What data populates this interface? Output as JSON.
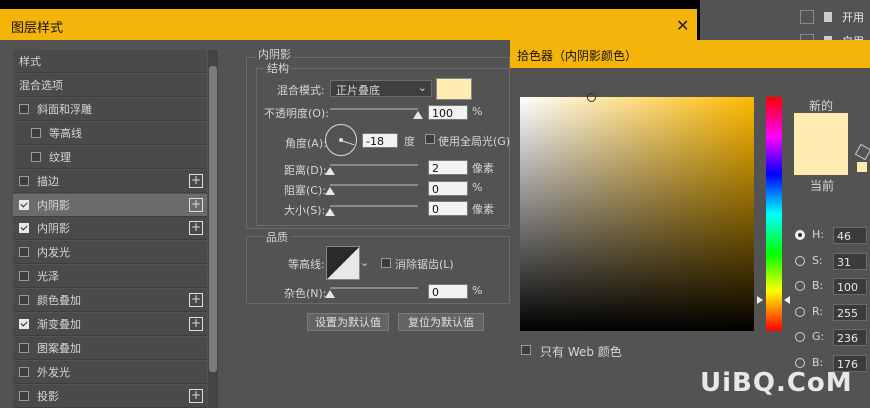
{
  "background": {
    "rows": [
      {
        "label": "开用"
      },
      {
        "label": "启用"
      },
      {
        "label": "使用"
      }
    ],
    "collapse_label": "«"
  },
  "dialog": {
    "title": "图层样式",
    "close_glyph": "✕",
    "list": {
      "header": "样式",
      "items": [
        {
          "label": "混合选项",
          "checkbox": false,
          "checked": false,
          "plus": false,
          "indent": false
        },
        {
          "label": "斜面和浮雕",
          "checkbox": true,
          "checked": false,
          "plus": false,
          "indent": false
        },
        {
          "label": "等高线",
          "checkbox": true,
          "checked": false,
          "plus": false,
          "indent": true
        },
        {
          "label": "纹理",
          "checkbox": true,
          "checked": false,
          "plus": false,
          "indent": true
        },
        {
          "label": "描边",
          "checkbox": true,
          "checked": false,
          "plus": true,
          "indent": false
        },
        {
          "label": "内阴影",
          "checkbox": true,
          "checked": true,
          "plus": true,
          "indent": false,
          "selected": true
        },
        {
          "label": "内阴影",
          "checkbox": true,
          "checked": true,
          "plus": true,
          "indent": false
        },
        {
          "label": "内发光",
          "checkbox": true,
          "checked": false,
          "plus": false,
          "indent": false
        },
        {
          "label": "光泽",
          "checkbox": true,
          "checked": false,
          "plus": false,
          "indent": false
        },
        {
          "label": "颜色叠加",
          "checkbox": true,
          "checked": false,
          "plus": true,
          "indent": false
        },
        {
          "label": "渐变叠加",
          "checkbox": true,
          "checked": true,
          "plus": true,
          "indent": false
        },
        {
          "label": "图案叠加",
          "checkbox": true,
          "checked": false,
          "plus": false,
          "indent": false
        },
        {
          "label": "外发光",
          "checkbox": true,
          "checked": false,
          "plus": false,
          "indent": false
        },
        {
          "label": "投影",
          "checkbox": true,
          "checked": false,
          "plus": true,
          "indent": false
        }
      ]
    },
    "inner_shadow": {
      "section_title": "内阴影",
      "structure_title": "结构",
      "blend_mode_label": "混合模式:",
      "blend_mode_value": "正片叠底",
      "swatch_color": "#ffecb0",
      "opacity_label": "不透明度(O):",
      "opacity_value": "100",
      "percent": "%",
      "angle_label": "角度(A):",
      "angle_value": "-18",
      "degree_unit": "度",
      "global_light_label": "使用全局光(G)",
      "distance_label": "距离(D):",
      "distance_value": "2",
      "pixel_unit": "像素",
      "choke_label": "阻塞(C):",
      "choke_value": "0",
      "size_label": "大小(S):",
      "size_value": "0",
      "quality_title": "品质",
      "contour_label": "等高线:",
      "antialias_label": "消除锯齿(L)",
      "noise_label": "杂色(N):",
      "noise_value": "0",
      "set_default_label": "设置为默认值",
      "reset_default_label": "复位为默认值",
      "levels": {
        "opacity": 1.0,
        "distance": 0.0,
        "choke": 0.0,
        "size": 0.0,
        "noise": 0.0
      }
    }
  },
  "color_picker": {
    "title": "拾色器（内阴影颜色）",
    "new_label": "新的",
    "current_label": "当前",
    "new_color": "#ffecb0",
    "web_only_label": "只有 Web 颜色",
    "fields": [
      {
        "label": "H:",
        "value": "46",
        "selected": true
      },
      {
        "label": "S:",
        "value": "31",
        "selected": false
      },
      {
        "label": "B:",
        "value": "100",
        "selected": false
      },
      {
        "label": "R:",
        "value": "255",
        "selected": false
      },
      {
        "label": "G:",
        "value": "236",
        "selected": false
      },
      {
        "label": "B:",
        "value": "176",
        "selected": false
      }
    ]
  },
  "watermark": {
    "text": "UiBQ.CoM"
  }
}
